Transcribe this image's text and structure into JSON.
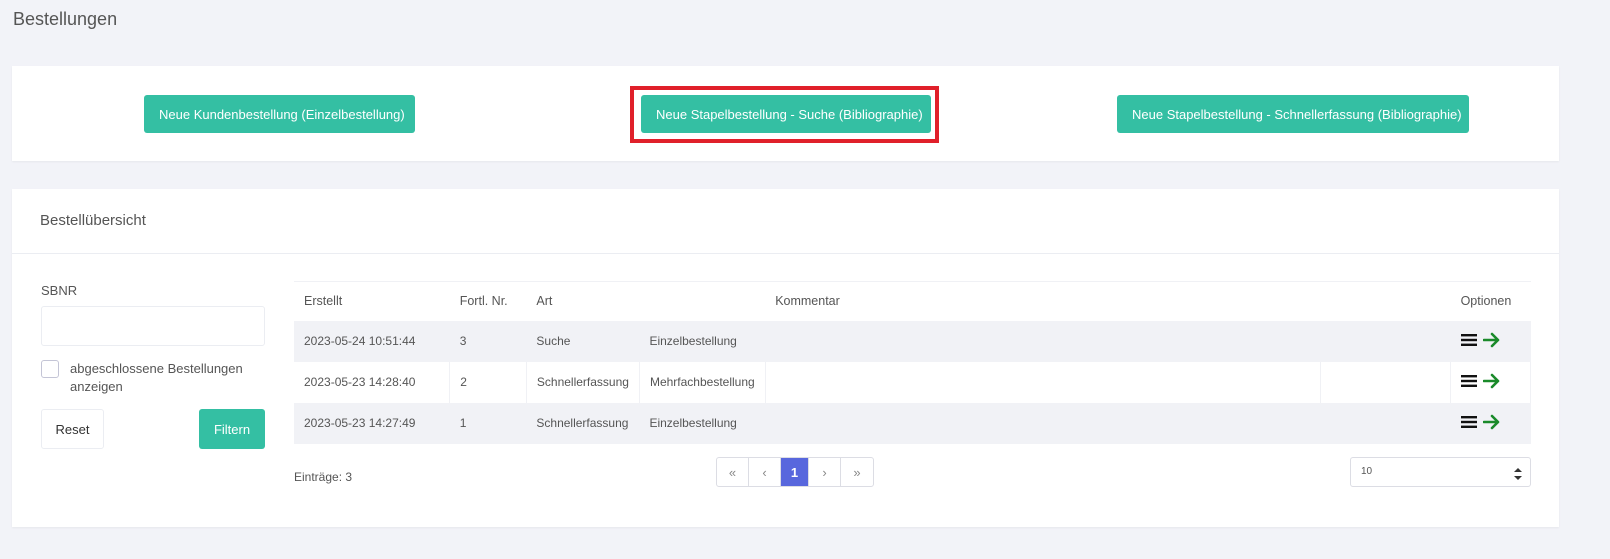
{
  "page": {
    "title": "Bestellungen"
  },
  "actions": {
    "new_customer_order": "Neue Kundenbestellung (Einzelbestellung)",
    "new_batch_search": "Neue Stapelbestellung - Suche (Bibliographie)",
    "new_batch_quick": "Neue Stapelbestellung - Schnellerfassung (Bibliographie)"
  },
  "overview": {
    "title": "Bestellübersicht",
    "filter": {
      "sbnr_label": "SBNR",
      "sbnr_value": "",
      "show_closed_label": "abgeschlossene Bestellungen anzeigen",
      "show_closed_checked": false,
      "reset_label": "Reset",
      "filter_label": "Filtern"
    },
    "table": {
      "columns": [
        "Erstellt",
        "Fortl. Nr.",
        "Art",
        "",
        "Kommentar",
        "Optionen"
      ],
      "rows": [
        {
          "created": "2023-05-24 10:51:44",
          "number": "3",
          "type": "Suche",
          "kind": "Einzelbestellung",
          "comment": ""
        },
        {
          "created": "2023-05-23 14:28:40",
          "number": "2",
          "type": "Schnellerfassung",
          "kind": "Mehrfachbestellung",
          "comment": ""
        },
        {
          "created": "2023-05-23 14:27:49",
          "number": "1",
          "type": "Schnellerfassung",
          "kind": "Einzelbestellung",
          "comment": ""
        }
      ],
      "row_icons": [
        "list-icon",
        "arrow-right-icon"
      ]
    },
    "footer": {
      "entries": "Einträge: 3",
      "pagination": {
        "first": "«",
        "prev": "‹",
        "current": "1",
        "next": "›",
        "last": "»"
      },
      "page_size": "10"
    }
  },
  "colors": {
    "teal": "#34bfa3",
    "highlight": "#e0202a",
    "active_page": "#5867dd",
    "arrow_green": "#1a8a2a"
  }
}
